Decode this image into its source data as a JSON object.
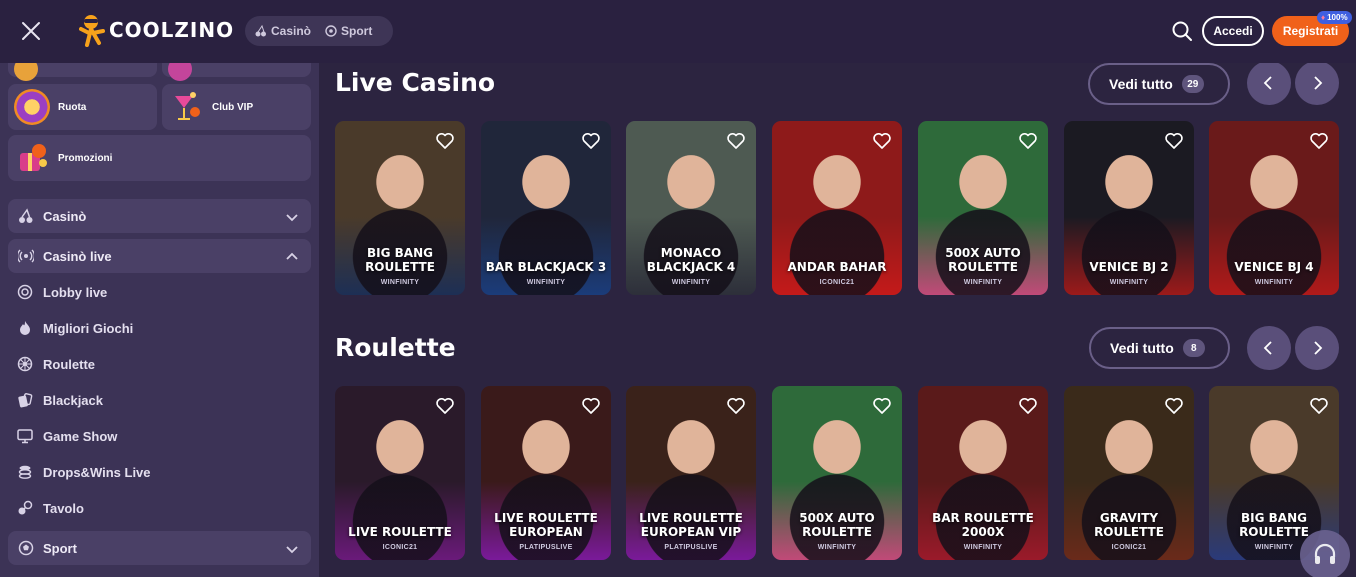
{
  "header": {
    "logo_text": "COOLZINO",
    "modes": [
      {
        "label": "Casinò",
        "icon": "cherries-icon"
      },
      {
        "label": "Sport",
        "icon": "soccer-ball-icon"
      }
    ],
    "login_label": "Accedi",
    "register_label": "Registrati",
    "bonus_badge": "100%",
    "accent_color": "#f0611a"
  },
  "sidebar": {
    "tiles": [
      {
        "label": "Ruota",
        "icon": "wheel-icon"
      },
      {
        "label": "Club VIP",
        "icon": "cocktail-icon"
      },
      {
        "label": "Promozioni",
        "icon": "gift-icon"
      }
    ],
    "groups": [
      {
        "label": "Casinò",
        "icon": "cherries-icon",
        "expanded": false
      },
      {
        "label": "Casinò live",
        "icon": "live-broadcast-icon",
        "expanded": true
      },
      {
        "label": "Sport",
        "icon": "soccer-ball-icon",
        "expanded": false
      }
    ],
    "live_items": [
      {
        "label": "Lobby live",
        "icon": "lobby-icon"
      },
      {
        "label": "Migliori Giochi",
        "icon": "flame-icon"
      },
      {
        "label": "Roulette",
        "icon": "roulette-icon"
      },
      {
        "label": "Blackjack",
        "icon": "cards-icon"
      },
      {
        "label": "Game Show",
        "icon": "monitor-icon"
      },
      {
        "label": "Drops&Wins Live",
        "icon": "coins-icon"
      },
      {
        "label": "Tavolo",
        "icon": "table-icon"
      }
    ]
  },
  "sections": [
    {
      "title": "Live Casino",
      "see_all": "Vedi tutto",
      "count": "29",
      "games": [
        {
          "name": "BIG BANG ROULETTE",
          "provider": "WINFINITY"
        },
        {
          "name": "BAR BLACKJACK 3",
          "provider": "WINFINITY"
        },
        {
          "name": "MONACO BLACKJACK 4",
          "provider": "WINFINITY"
        },
        {
          "name": "ANDAR BAHAR",
          "provider": "ICONIC21"
        },
        {
          "name": "500X AUTO ROULETTE",
          "provider": "WINFINITY"
        },
        {
          "name": "VENICE BJ 2",
          "provider": "WINFINITY"
        },
        {
          "name": "VENICE BJ 4",
          "provider": "WINFINITY"
        }
      ]
    },
    {
      "title": "Roulette",
      "see_all": "Vedi tutto",
      "count": "8",
      "games": [
        {
          "name": "LIVE ROULETTE",
          "provider": "ICONIC21"
        },
        {
          "name": "LIVE ROULETTE EUROPEAN",
          "provider": "PLATIPUSLIVE"
        },
        {
          "name": "LIVE ROULETTE EUROPEAN VIP",
          "provider": "PLATIPUSLIVE"
        },
        {
          "name": "500X AUTO ROULETTE",
          "provider": "WINFINITY"
        },
        {
          "name": "BAR ROULETTE 2000X",
          "provider": "WINFINITY"
        },
        {
          "name": "GRAVITY ROULETTE",
          "provider": "ICONIC21"
        },
        {
          "name": "BIG BANG ROULETTE",
          "provider": "WINFINITY"
        }
      ]
    }
  ]
}
